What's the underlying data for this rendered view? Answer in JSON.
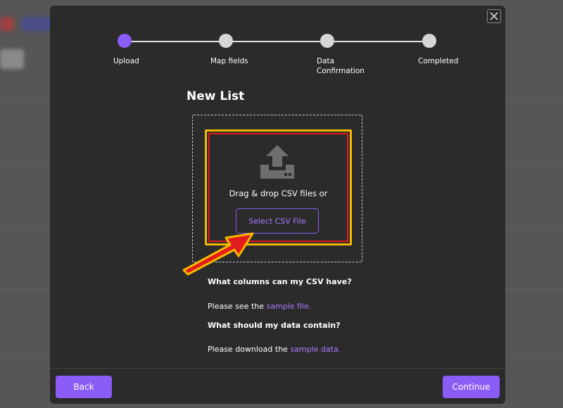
{
  "modal": {
    "title": "New List",
    "close_icon": "close-icon"
  },
  "stepper": {
    "steps": [
      {
        "label": "Upload",
        "state": "active"
      },
      {
        "label": "Map fields",
        "state": "pending"
      },
      {
        "label": "Data Confirmation",
        "state": "pending"
      },
      {
        "label": "Completed",
        "state": "pending"
      }
    ]
  },
  "dropzone": {
    "icon": "upload-icon",
    "prompt": "Drag & drop CSV files or",
    "select_button": "Select CSV File"
  },
  "info": {
    "columns_question": "What columns can my CSV have?",
    "columns_text": "Please see the",
    "columns_link": "sample file.",
    "data_question": "What should my data contain?",
    "data_text": "Please download the",
    "data_link": "sample data."
  },
  "footer": {
    "back_label": "Back",
    "continue_label": "Continue"
  },
  "colors": {
    "accent": "#8b5cf6",
    "modal_bg": "#2b2b2b",
    "highlight_outer": "#f5b800",
    "highlight_inner": "#e21b1b"
  }
}
